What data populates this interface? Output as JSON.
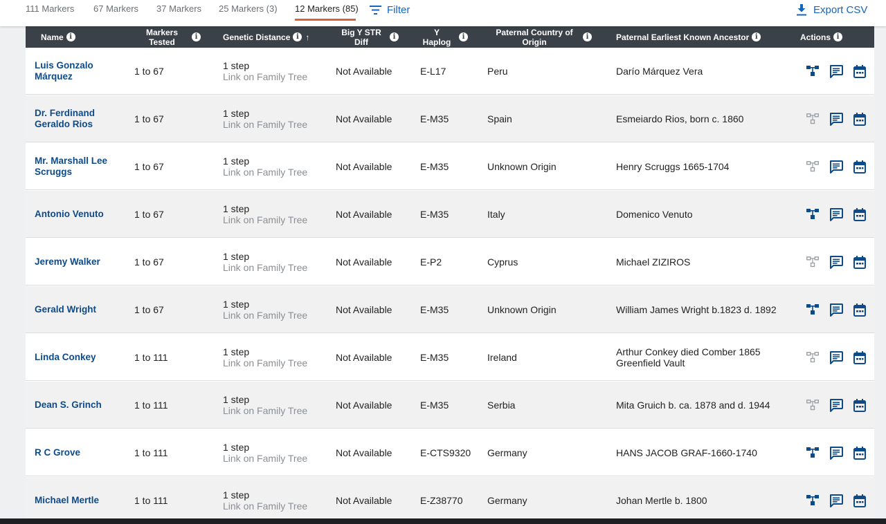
{
  "tabs": [
    {
      "label": "111 Markers",
      "active": false
    },
    {
      "label": "67 Markers",
      "active": false
    },
    {
      "label": "37 Markers",
      "active": false
    },
    {
      "label": "25 Markers (3)",
      "active": false
    },
    {
      "label": "12 Markers (85)",
      "active": true
    }
  ],
  "filter_label": "Filter",
  "export_label": "Export CSV",
  "headers": {
    "name": "Name",
    "markers_tested": "Markers Tested",
    "genetic_distance": "Genetic Distance",
    "big_y": "Big Y STR Diff",
    "haplog": "Y Haplog",
    "country": "Paternal Country of Origin",
    "ancestor": "Paternal Earliest Known Ancestor",
    "actions": "Actions"
  },
  "info_glyph": "i",
  "sort_glyph": "↑",
  "rows": [
    {
      "name": "Luis Gonzalo Márquez",
      "markers": "1 to 67",
      "distance": "1 step",
      "tree_link": "Link on Family Tree",
      "bigy": "Not Available",
      "haplo": "E-L17",
      "country": "Peru",
      "ancestor": "Darío Márquez Vera",
      "tree_icon_active": true
    },
    {
      "name": "Dr. Ferdinand Geraldo Rios",
      "markers": "1 to 67",
      "distance": "1 step",
      "tree_link": "Link on Family Tree",
      "bigy": "Not Available",
      "haplo": "E-M35",
      "country": "Spain",
      "ancestor": "Esmeiardo Rios, born c. 1860",
      "tree_icon_active": false
    },
    {
      "name": "Mr. Marshall Lee Scruggs",
      "markers": "1 to 67",
      "distance": "1 step",
      "tree_link": "Link on Family Tree",
      "bigy": "Not Available",
      "haplo": "E-M35",
      "country": "Unknown Origin",
      "ancestor": "Henry Scruggs 1665-1704",
      "tree_icon_active": false
    },
    {
      "name": "Antonio Venuto",
      "markers": "1 to 67",
      "distance": "1 step",
      "tree_link": "Link on Family Tree",
      "bigy": "Not Available",
      "haplo": "E-M35",
      "country": "Italy",
      "ancestor": "Domenico Venuto",
      "tree_icon_active": true
    },
    {
      "name": "Jeremy Walker",
      "markers": "1 to 67",
      "distance": "1 step",
      "tree_link": "Link on Family Tree",
      "bigy": "Not Available",
      "haplo": "E-P2",
      "country": "Cyprus",
      "ancestor": "Michael ZIZIROS",
      "tree_icon_active": false
    },
    {
      "name": "Gerald Wright",
      "markers": "1 to 67",
      "distance": "1 step",
      "tree_link": "Link on Family Tree",
      "bigy": "Not Available",
      "haplo": "E-M35",
      "country": "Unknown Origin",
      "ancestor": "William James Wright b.1823 d. 1892",
      "tree_icon_active": true
    },
    {
      "name": "Linda Conkey",
      "markers": "1 to 111",
      "distance": "1 step",
      "tree_link": "Link on Family Tree",
      "bigy": "Not Available",
      "haplo": "E-M35",
      "country": "Ireland",
      "ancestor": "Arthur Conkey died Comber 1865 Greenfield Vault",
      "tree_icon_active": false
    },
    {
      "name": "Dean S. Grinch",
      "markers": "1 to 111",
      "distance": "1 step",
      "tree_link": "Link on Family Tree",
      "bigy": "Not Available",
      "haplo": "E-M35",
      "country": "Serbia",
      "ancestor": "Mita Gruich b. ca. 1878 and d. 1944",
      "tree_icon_active": false
    },
    {
      "name": "R C Grove",
      "markers": "1 to 111",
      "distance": "1 step",
      "tree_link": "Link on Family Tree",
      "bigy": "Not Available",
      "haplo": "E-CTS9320",
      "country": "Germany",
      "ancestor": "HANS JACOB GRAF-1660-1740",
      "tree_icon_active": true
    },
    {
      "name": "Michael Mertle",
      "markers": "1 to 111",
      "distance": "1 step",
      "tree_link": "Link on Family Tree",
      "bigy": "Not Available",
      "haplo": "E-Z38770",
      "country": "Germany",
      "ancestor": "Johan Mertle b. 1800",
      "tree_icon_active": true
    }
  ],
  "colors": {
    "accent": "#1565c0",
    "link": "#0d4a8a",
    "header_bg": "#3b4148",
    "tab_underline": "#e0603a",
    "tree_active": "#0d4a8a",
    "tree_inactive": "#9aa0a6"
  },
  "icons": [
    "filter-icon",
    "download-icon",
    "info-icon",
    "sort-arrow-icon",
    "family-tree-icon",
    "notes-icon",
    "calendar-icon"
  ]
}
